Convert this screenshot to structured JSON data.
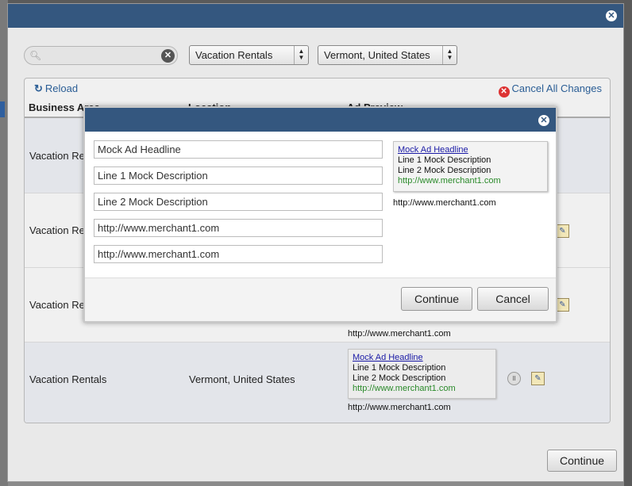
{
  "toolbar": {
    "search_placeholder": "",
    "category": "Vacation Rentals",
    "location": "Vermont, United States",
    "reload_label": "Reload",
    "cancel_all_label": "Cancel All Changes"
  },
  "table": {
    "headers": [
      "Business Area",
      "Location",
      "Ad Preview"
    ],
    "rows": [
      {
        "business_area": "Vacation Rentals"
      },
      {
        "business_area": "Vacation Rentals"
      },
      {
        "business_area": "Vacation Rentals",
        "display_url": "http://www.merchant1.com"
      },
      {
        "business_area": "Vacation Rentals",
        "location": "Vermont, United States",
        "ad": {
          "headline": "Mock Ad Headline",
          "line1": "Line 1 Mock Description",
          "line2": "Line 2 Mock Description",
          "url": "http://www.merchant1.com"
        },
        "display_url": "http://www.merchant1.com"
      }
    ]
  },
  "footer": {
    "continue_label": "Continue"
  },
  "modal": {
    "fields": {
      "headline": "Mock Ad Headline",
      "line1": "Line 1 Mock Description",
      "line2": "Line 2 Mock Description",
      "display_url": "http://www.merchant1.com",
      "destination_url": "http://www.merchant1.com"
    },
    "preview": {
      "headline": "Mock Ad Headline",
      "line1": "Line 1 Mock Description",
      "line2": "Line 2 Mock Description",
      "url": "http://www.merchant1.com"
    },
    "preview_display_url": "http://www.merchant1.com",
    "continue_label": "Continue",
    "cancel_label": "Cancel"
  },
  "colors": {
    "title_bar": "#34577f",
    "link": "#2a5d95",
    "ad_url": "#2a8a2a",
    "ad_headline": "#1a1aa6"
  },
  "icons": [
    "close-icon",
    "search-icon",
    "clear-icon",
    "reload-icon",
    "cancel-icon",
    "edit-icon"
  ]
}
